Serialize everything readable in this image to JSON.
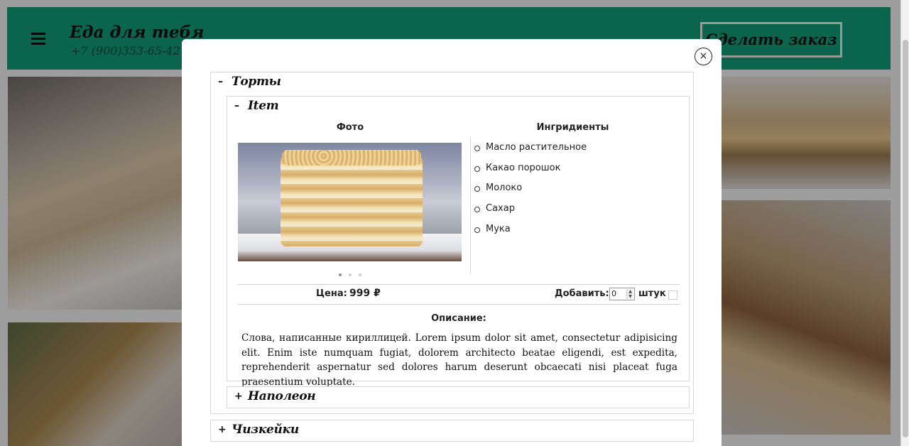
{
  "header": {
    "brand_title": "Еда для тебя",
    "phone": "+7 (900)353-65-42",
    "order_button": "Сделать заказ",
    "accent_color": "#119c77"
  },
  "modal": {
    "close_icon": "×",
    "categories": [
      {
        "title": "Торты",
        "sign": "–",
        "expanded": true,
        "items": [
          {
            "title": "Item",
            "sign": "–",
            "expanded": true,
            "photo_header": "Фото",
            "photo_alt": "cake-photo",
            "carousel_dots": 3,
            "carousel_active": 1,
            "ingredients_header": "Ингридиенты",
            "ingredients": [
              "Масло растительное",
              "Какао порошок",
              "Молоко",
              "Сахар",
              "Мука"
            ],
            "price_label": "Цена:",
            "price_value": "999 ₽",
            "add_label": "Добавить:",
            "quantity": "0",
            "unit_label": "штук",
            "description_header": "Описание:",
            "description": "Слова, написанные кириллицей. Lorem ipsum dolor sit amet, consectetur adipisicing elit. Enim iste numquam fugiat, dolorem architecto beatae eligendi, est expedita, reprehenderit aspernatur sed dolores harum deserunt obcaecati nisi placeat fuga praesentium voluptate."
          },
          {
            "title": "Наполеон",
            "sign": "+",
            "expanded": false
          }
        ]
      },
      {
        "title": "Чизкейки",
        "sign": "+",
        "expanded": false
      }
    ]
  }
}
